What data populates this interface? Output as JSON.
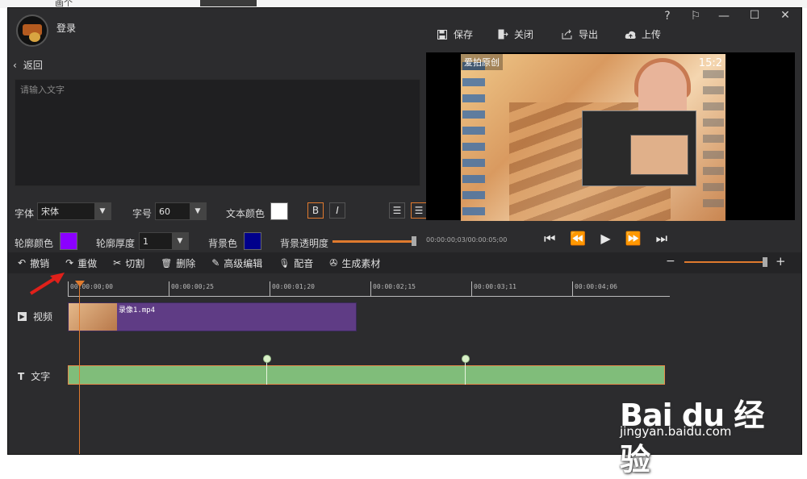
{
  "bg": {
    "top_text": "画个"
  },
  "header": {
    "login_label": "登录",
    "window_controls": [
      "?",
      "⚐",
      "—",
      "☐",
      "✕"
    ],
    "toolbar": [
      {
        "label": "保存",
        "icon": "save-icon"
      },
      {
        "label": "关闭",
        "icon": "close-exit-icon"
      },
      {
        "label": "导出",
        "icon": "export-icon"
      },
      {
        "label": "上传",
        "icon": "upload-cloud-icon"
      }
    ]
  },
  "left": {
    "back_label": "返回",
    "text_placeholder": "请输入文字",
    "font_label": "字体",
    "font_value": "宋体",
    "size_label": "字号",
    "size_value": "60",
    "text_color_label": "文本颜色",
    "text_color": "#ffffff",
    "bold_label": "B",
    "italic_label": "I",
    "align_labels": [
      "☰",
      "☰"
    ],
    "outline_color_label": "轮廓颜色",
    "outline_color": "#8b00ff",
    "outline_thickness_label": "轮廓厚度",
    "outline_thickness_value": "1",
    "bg_color_label": "背景色",
    "bg_color": "#00008b",
    "bg_opacity_label": "背景透明度",
    "bg_opacity": 1.0
  },
  "preview": {
    "watermark": "爱拍原创",
    "clock": "15:2",
    "timecode": "00:00:00;03/00:00:05;00",
    "controls": [
      "⏮",
      "⏪",
      "▶",
      "⏩",
      "⏭"
    ]
  },
  "editbar": {
    "items": [
      {
        "label": "撤销",
        "icon": "undo-icon",
        "glyph": "↶"
      },
      {
        "label": "重做",
        "icon": "redo-icon",
        "glyph": "↷"
      },
      {
        "label": "切割",
        "icon": "scissors-icon",
        "glyph": "✂"
      },
      {
        "label": "删除",
        "icon": "trash-icon",
        "glyph": "🗑"
      },
      {
        "label": "高级编辑",
        "icon": "pen-icon",
        "glyph": "✎"
      },
      {
        "label": "配音",
        "icon": "microphone-icon",
        "glyph": "🎙"
      },
      {
        "label": "生成素材",
        "icon": "film-reel-icon",
        "glyph": "✇"
      }
    ],
    "zoom_minus": "−",
    "zoom_plus": "+"
  },
  "timeline": {
    "ticks": [
      "00:00:00;00",
      "00:00:00;25",
      "00:00:01;20",
      "00:00:02;15",
      "00:00:03;11",
      "00:00:04;06"
    ],
    "video_track_label": "视频",
    "text_track_label": "文字",
    "video_clip_name": "录像1.mp4"
  },
  "watermark": {
    "brand": "Bai du 经验",
    "url": "jingyan.baidu.com"
  }
}
